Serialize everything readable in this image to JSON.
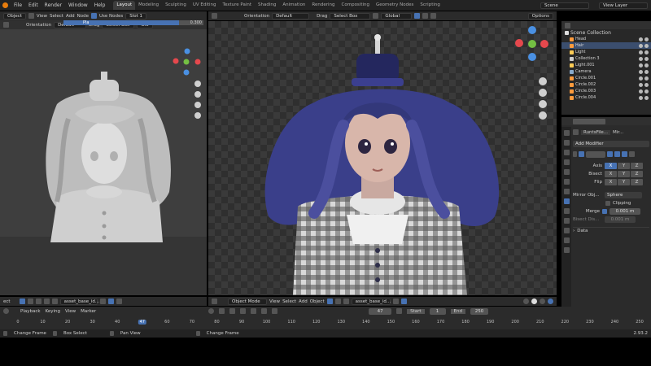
{
  "top_menu": [
    "File",
    "Edit",
    "Render",
    "Window",
    "Help"
  ],
  "workspaces": [
    "Layout",
    "Modeling",
    "Sculpting",
    "UV Editing",
    "Texture Paint",
    "Shading",
    "Animation",
    "Rendering",
    "Compositing",
    "Geometry Nodes",
    "Scripting"
  ],
  "active_workspace": "Layout",
  "scene": "Scene",
  "view_layer": "View Layer",
  "uv_header": {
    "mode": "Object",
    "view": "View",
    "select": "Select",
    "add": "Add",
    "node": "Node",
    "use_nodes": "Use Nodes",
    "slot": "Slot 1"
  },
  "left_toolbar": {
    "orientation": "Orientation",
    "orient_value": "Default",
    "drag": "Drag",
    "drag_value": "Select Box",
    "global": "Glo"
  },
  "left_strip": {
    "field": "Pla",
    "value": "0.300"
  },
  "viewport_header": {
    "orientation": "Orientation",
    "orient_value": "Default",
    "drag": "Drag",
    "drag_value": "Select Box",
    "transform": "Global",
    "options": "Options"
  },
  "outliner": {
    "title": "Scene Collection",
    "items": [
      {
        "name": "Head"
      },
      {
        "name": "Hair"
      },
      {
        "name": "Light"
      },
      {
        "name": "Collection 3"
      },
      {
        "name": "Light.001"
      },
      {
        "name": "Camera"
      },
      {
        "name": "Circle.001"
      },
      {
        "name": "Circle.002"
      },
      {
        "name": "Circle.003"
      },
      {
        "name": "Circle.004"
      }
    ]
  },
  "properties": {
    "object": "RuntsFile...",
    "modifier_short": "Mir...",
    "add_modifier": "Add Modifier",
    "axis": "Axis",
    "bisect": "Bisect",
    "flip": "Flip",
    "mirror_object_label": "Mirror Obj...",
    "mirror_object_value": "Sphere",
    "clipping": "Clipping",
    "merge": "Merge",
    "merge_value": "0.001 m",
    "bisect_dist": "Bisect Dis...",
    "bisect_dist_value": "0.001 m",
    "data": "Data",
    "xyz": [
      "X",
      "Y",
      "Z"
    ]
  },
  "left_bottom": {
    "prefix": "ect",
    "file": "asset_base_id..."
  },
  "main_bottom": {
    "mode": "Object Mode",
    "view": "View",
    "select": "Select",
    "add": "Add",
    "object": "Object",
    "file": "asset_base_id..."
  },
  "timeline": {
    "playback": "Playback",
    "keying": "Keying",
    "view": "View",
    "marker": "Marker",
    "current_frame": "47",
    "start_label": "Start",
    "start": "1",
    "end_label": "End",
    "end": "250",
    "ticks": [
      "0",
      "10",
      "20",
      "30",
      "40",
      "47",
      "60",
      "70",
      "80",
      "90",
      "100",
      "110",
      "120",
      "130",
      "140",
      "150",
      "160",
      "170",
      "180",
      "190",
      "200",
      "210",
      "220",
      "230",
      "240",
      "250"
    ]
  },
  "status": {
    "change_frame": "Change Frame",
    "box_select": "Box Select",
    "pan_view": "Pan View",
    "change_frame2": "Change Frame",
    "version": "2.93.2"
  },
  "colors": {
    "accent": "#4772b3",
    "x_axis": "#e5484d",
    "y_axis": "#74c043",
    "z_axis": "#4a90e2"
  }
}
